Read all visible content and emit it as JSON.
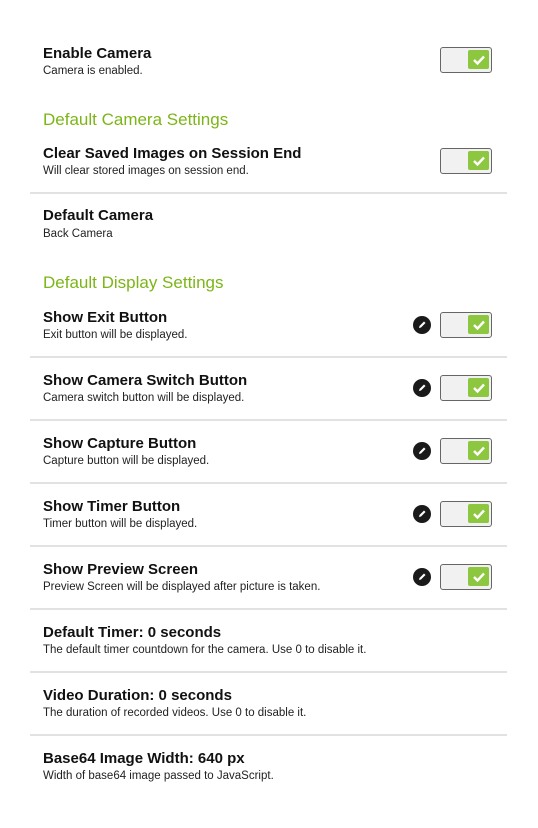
{
  "accent_color": "#7cb518",
  "toggle_color": "#8dc63f",
  "enable_camera": {
    "title": "Enable Camera",
    "subtitle": "Camera is enabled.",
    "enabled": true
  },
  "sections": {
    "camera": {
      "header": "Default Camera Settings"
    },
    "display": {
      "header": "Default Display Settings"
    }
  },
  "clear_saved": {
    "title": "Clear Saved Images on Session End",
    "subtitle": "Will clear stored images on session end.",
    "enabled": true
  },
  "default_camera": {
    "title": "Default Camera",
    "subtitle": "Back Camera"
  },
  "display_items": [
    {
      "title": "Show Exit Button",
      "subtitle": "Exit button will be displayed.",
      "enabled": true
    },
    {
      "title": "Show Camera Switch Button",
      "subtitle": "Camera switch button will be displayed.",
      "enabled": true
    },
    {
      "title": "Show Capture Button",
      "subtitle": "Capture button will be displayed.",
      "enabled": true
    },
    {
      "title": "Show Timer Button",
      "subtitle": "Timer button will be displayed.",
      "enabled": true
    },
    {
      "title": "Show Preview Screen",
      "subtitle": "Preview Screen will be displayed after picture is taken.",
      "enabled": true
    }
  ],
  "value_items": [
    {
      "title": "Default Timer: 0 seconds",
      "subtitle": "The default timer countdown for the camera. Use 0 to disable it."
    },
    {
      "title": "Video Duration: 0 seconds",
      "subtitle": "The duration of recorded videos. Use 0 to disable it."
    },
    {
      "title": "Base64 Image Width: 640 px",
      "subtitle": "Width of base64 image passed to JavaScript."
    }
  ]
}
